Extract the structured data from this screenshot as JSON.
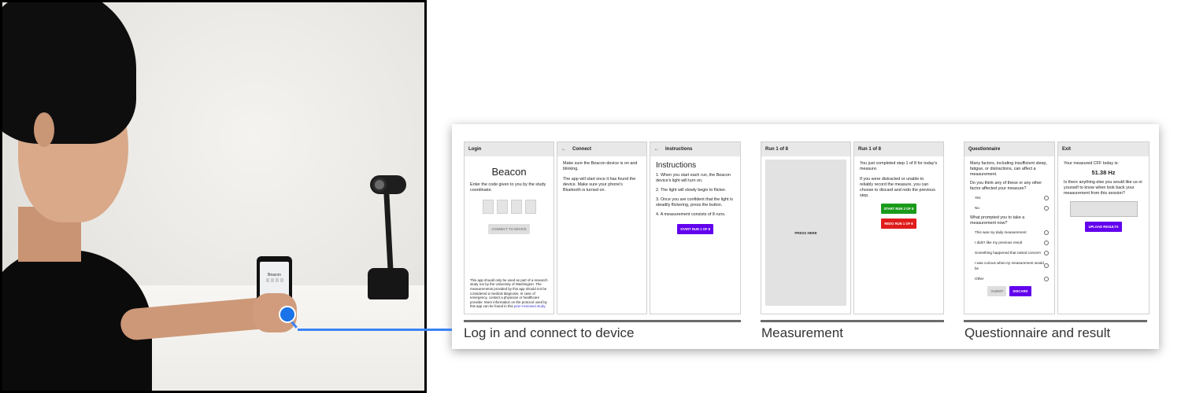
{
  "photo": {
    "phone_title": "Beacon"
  },
  "login": {
    "bar": "Login",
    "title": "Beacon",
    "prompt": "Enter the code given to you by the study coordinator.",
    "connect_button": "CONNECT TO DEVICE",
    "disclaimer": "This app should only be used as part of a research study run by the University of Washington. The measurements provided by this app should not be considered a medical diagnosis. In case of emergency, contact a physician or healthcare provider. More information on the protocol used by this app can be found in this",
    "disclaimer_link": "peer-reviewed study."
  },
  "connect": {
    "bar": "Connect",
    "back": "←",
    "p1": "Make sure the Beacon device is on and blinking.",
    "p2": "The app will start once it has found the device. Make sure your phone's Bluetooth is turned on."
  },
  "instructions": {
    "bar": "Instructions",
    "back": "←",
    "title": "Instructions",
    "steps": [
      "1. When you start each run, the Beacon device's light will turn on.",
      "2. The light will slowly begin to flicker.",
      "3. Once you are confident that the light is steadily flickering, press the button.",
      "4. A measurement consists of 8 runs."
    ],
    "start_button": "START RUN 1 OF 8"
  },
  "run_a": {
    "bar": "Run 1 of 8",
    "press": "PRESS HERE"
  },
  "run_b": {
    "bar": "Run 1 of 8",
    "p1": "You just completed step 1 of 8 for today's measure.",
    "p2": "If you were distracted or unable to reliably record the measure, you can choose to discard and redo the previous step.",
    "start_button": "START RUN 2 OF 8",
    "redo_button": "REDO RUN 1 OF 8"
  },
  "questionnaire": {
    "bar": "Questionnaire",
    "intro": "Many factors, including insufficient sleep, fatigue, or distractions, can affect a measurement.",
    "q1": "Do you think any of these or any other factor affected your measure?",
    "q1_options": [
      "Yes",
      "No"
    ],
    "q2": "What prompted you to take a measurement now?",
    "q2_options": [
      "This was my daily measurement",
      "I didn't like my previous result",
      "Something happened that raised concern",
      "I was curious what my measurement would be",
      "Other"
    ],
    "submit_button": "SUBMIT",
    "discard_button": "DISCARD"
  },
  "exit": {
    "bar": "Exit",
    "label": "Your measured CFF today is:",
    "value": "51.38 Hz",
    "question": "Is there anything else you would like us or yourself to know when look back your measurement from this session?",
    "upload_button": "UPLOAD RESULTS"
  },
  "sections": {
    "login_connect": "Log in and connect to device",
    "measurement": "Measurement",
    "questionnaire_result": "Questionnaire and result"
  },
  "colors": {
    "connector": "#3b82f6",
    "primary_button": "#6200ee",
    "start_button": "#1a9a1a",
    "redo_button": "#e01b1b"
  }
}
